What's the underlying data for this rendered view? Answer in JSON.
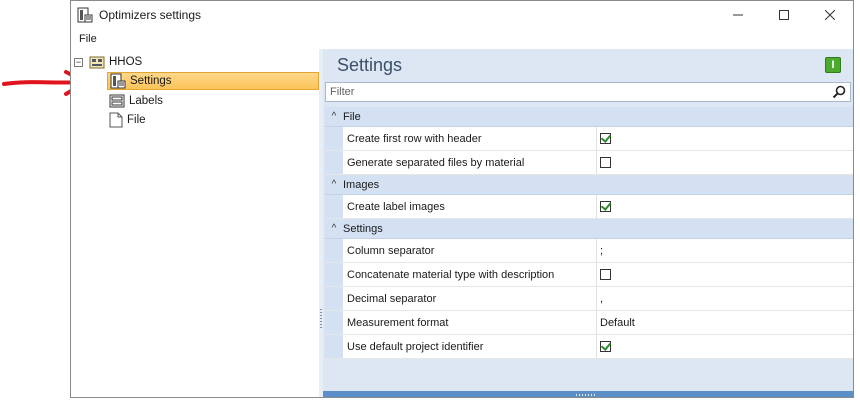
{
  "window": {
    "title": "Optimizers settings"
  },
  "menu": {
    "file": "File"
  },
  "tree": {
    "root": "HHOS",
    "items": [
      {
        "label": "Settings",
        "icon": "settings-doc-icon",
        "selected": true
      },
      {
        "label": "Labels",
        "icon": "labels-icon",
        "selected": false
      },
      {
        "label": "File",
        "icon": "file-icon",
        "selected": false
      }
    ]
  },
  "settings": {
    "title": "Settings",
    "info_badge": "I",
    "filter_placeholder": "Filter",
    "categories": [
      {
        "name": "File",
        "props": [
          {
            "name": "Create first row with header",
            "type": "checkbox",
            "checked": true
          },
          {
            "name": "Generate separated files by material",
            "type": "checkbox",
            "checked": false
          }
        ]
      },
      {
        "name": "Images",
        "props": [
          {
            "name": "Create label images",
            "type": "checkbox",
            "checked": true
          }
        ]
      },
      {
        "name": "Settings",
        "props": [
          {
            "name": "Column separator",
            "type": "text",
            "value": ";"
          },
          {
            "name": "Concatenate material type with description",
            "type": "checkbox",
            "checked": false
          },
          {
            "name": "Decimal separator",
            "type": "text",
            "value": ","
          },
          {
            "name": "Measurement format",
            "type": "text",
            "value": "Default"
          },
          {
            "name": "Use default project identifier",
            "type": "checkbox",
            "checked": true
          }
        ]
      }
    ]
  },
  "colors": {
    "accent": "#5b8fc8",
    "selection": "#fbc35a",
    "annotation_arrow": "#e0141e"
  }
}
